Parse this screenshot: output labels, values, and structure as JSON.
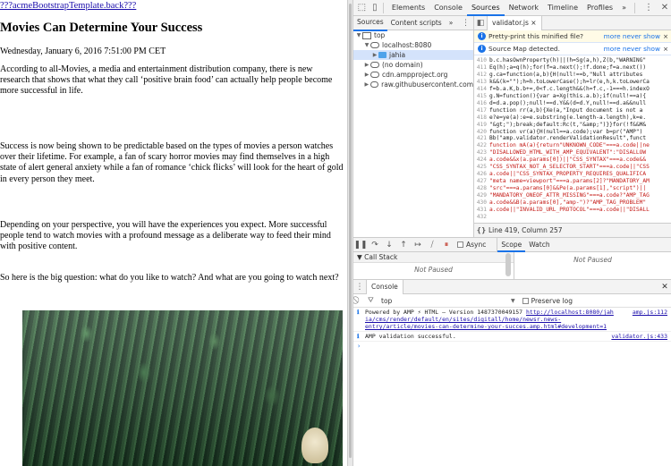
{
  "page": {
    "top_link": "???acmeBootstrapTemplate.back???",
    "title": "Movies Can Determine Your Success",
    "date": "Wednesday, January 6, 2016 7:51:00 PM CET",
    "paragraphs": [
      "According to all-Movies, a media and entertainment distribution company, there is new research that shows that what they call ‘positive brain food’ can actually help people become more successful in life.",
      "Success is now being shown to be predictable based on the types of movies a person watches over their lifetime. For example, a fan of scary horror movies may find themselves in a high state of alert general anxiety while a fan of romance ‘chick flicks’ will look for the heart of gold in every person they meet.",
      "Depending on your perspective, you will have the experiences you expect. More successful people tend to watch movies with a profound message as a deliberate way to feed their mind with positive content.",
      "So here is the big question: what do you like to watch? And what are you going to watch next?"
    ]
  },
  "devtools": {
    "top_tabs": [
      "Elements",
      "Console",
      "Sources",
      "Network",
      "Timeline",
      "Profiles"
    ],
    "active_top_tab": "Sources",
    "more": "»",
    "kebab": "⋮",
    "close": "✕",
    "navigator": {
      "tabs": [
        "Sources",
        "Content scripts"
      ],
      "more": "»",
      "kebab": "⋮",
      "tree": [
        {
          "label": "top",
          "indent": 0,
          "arrow": "▼",
          "kind": "frame"
        },
        {
          "label": "localhost:8080",
          "indent": 1,
          "arrow": "▼",
          "kind": "cloud"
        },
        {
          "label": "jahia",
          "indent": 2,
          "arrow": "▶",
          "kind": "folder",
          "selected": true
        },
        {
          "label": "(no domain)",
          "indent": 1,
          "arrow": "▶",
          "kind": "cloud"
        },
        {
          "label": "cdn.ampproject.org",
          "indent": 1,
          "arrow": "▶",
          "kind": "cloud"
        },
        {
          "label": "raw.githubusercontent.com",
          "indent": 1,
          "arrow": "▶",
          "kind": "cloud"
        }
      ]
    },
    "editor": {
      "file_tab": "validator.js",
      "file_close": "×",
      "info_bars": [
        {
          "text": "Pretty-print this minified file?",
          "more": "more",
          "never": "never show",
          "close": "×"
        },
        {
          "text": "Source Map detected.",
          "more": "more",
          "never": "never show",
          "close": "×"
        }
      ],
      "code_lines": [
        {
          "n": "410",
          "t": "b.c.hasOwnProperty(h)||(h=Sg(a,h),Z(b,\"WARNING\""
        },
        {
          "n": "411",
          "t": "Eq(h);a=q(h);for(f=a.next();!f.done;f=a.next())"
        },
        {
          "n": "412",
          "t": "g.ca=function(a,b){H(null!==b,\"Null attributes"
        },
        {
          "n": "413",
          "t": "k&&(k=\"\");h=h.toLowerCase();h=lr(e,h,k.toLowerCa"
        },
        {
          "n": "414",
          "t": "f=b.a.K,b.b+=,0<f.c.length&&(h=f.c,-1===h.indexO"
        },
        {
          "n": "415",
          "t": "g.N=function(){var a=Xg(this.a.b);if(null!==a){"
        },
        {
          "n": "416",
          "t": "d=d.a.pop();null!==d.Y&&(d=d.Y,null!==d.a&&null"
        },
        {
          "n": "417",
          "t": "function rr(a,b){Xe(a,\"Input document is not a"
        },
        {
          "n": "418",
          "t": "e?e=ye(a):e=e.substring(e.length-a.length),k=e."
        },
        {
          "n": "419",
          "t": "\"&gt;\");break;default:Rc(t,\"&amp;\")}}for(!f&&M&"
        },
        {
          "n": "420",
          "t": "function vr(a){H(null==a.code);var b=pr(\"AMP\")"
        },
        {
          "n": "421",
          "t": "Bb(\"amp.validator.renderValidationResult\",funct"
        },
        {
          "n": "422",
          "t": "function mA(a){return\"UNKNOWN_CODE\"===a.code||ne"
        },
        {
          "n": "423",
          "t": "\"DISALLOWED_HTML_WITH_AMP_EQUIVALENT\":\"DISALLOW"
        },
        {
          "n": "424",
          "t": "a.code&&x(a.params[0])||\"CSS_SYNTAX\"===a.code&&"
        },
        {
          "n": "425",
          "t": "\"CSS_SYNTAX_NOT_A_SELECTOR_START\"===a.code||\"CSS"
        },
        {
          "n": "426",
          "t": "a.code||\"CSS_SYNTAX_PROPERTY_REQUIRES_QUALIFICA"
        },
        {
          "n": "427",
          "t": "\"meta name=viewport\"===a.params[2]?\"MANDATORY_AM"
        },
        {
          "n": "428",
          "t": "\"src\"===a.params[0]&&Pe(a.params[1],\"script\")||"
        },
        {
          "n": "429",
          "t": "\"MANDATORY_ONEOF_ATTR_MISSING\"===a.code?\"AMP_TAG"
        },
        {
          "n": "430",
          "t": "a.code&&B(a.params[0],\"amp-\")?\"AMP_TAG_PROBLEM\""
        },
        {
          "n": "431",
          "t": "a.code||\"INVALID_URL_PROTOCOL\"===a.code||\"DISALL"
        },
        {
          "n": "432",
          "t": ""
        }
      ],
      "status_text": "Line 419, Column 257",
      "braces": "{}"
    },
    "debugger": {
      "async_label": "Async",
      "tabs": [
        "Scope",
        "Watch"
      ],
      "call_stack_label": "Call Stack",
      "not_paused_left": "Not Paused",
      "not_paused_right": "Not Paused"
    },
    "console": {
      "tab": "Console",
      "context": "top",
      "preserve_log": "Preserve log",
      "messages": [
        {
          "prefix": "Powered by AMP ⚡ HTML – Version 1487370049157 ",
          "link": "http://localhost:8080/jah ia/cms/render/default/en/sites/digitall/home/newsr.news-entry/article/movies-can-determine-your-succes.amp.html#development=1",
          "source": "amp.js:112"
        },
        {
          "prefix": "AMP validation successful.",
          "link": "",
          "source": "validator.js:433"
        }
      ],
      "prompt": "›"
    }
  }
}
